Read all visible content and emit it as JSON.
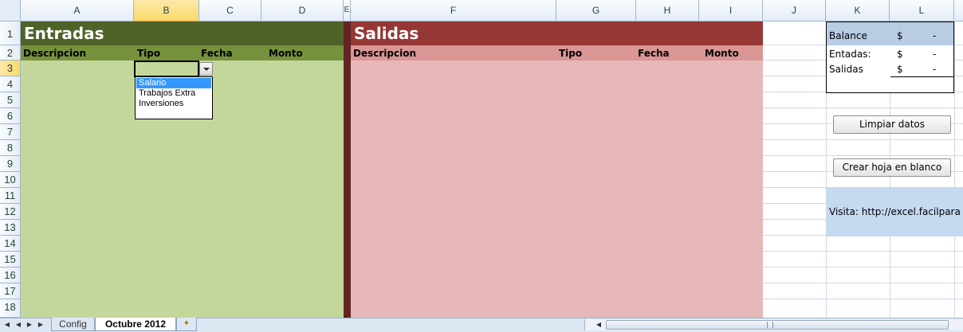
{
  "columns": [
    {
      "id": "A",
      "label": "A"
    },
    {
      "id": "B",
      "label": "B"
    },
    {
      "id": "C",
      "label": "C"
    },
    {
      "id": "D",
      "label": "D"
    },
    {
      "id": "E",
      "label": "E"
    },
    {
      "id": "F",
      "label": "F"
    },
    {
      "id": "G",
      "label": "G"
    },
    {
      "id": "H",
      "label": "H"
    },
    {
      "id": "I",
      "label": "I"
    },
    {
      "id": "J",
      "label": "J"
    },
    {
      "id": "K",
      "label": "K"
    },
    {
      "id": "L",
      "label": "L"
    }
  ],
  "rows": [
    "1",
    "2",
    "3",
    "4",
    "5",
    "6",
    "7",
    "8",
    "9",
    "10",
    "11",
    "12",
    "13",
    "14",
    "15",
    "16",
    "17",
    "18"
  ],
  "selected_cell": "B3",
  "entradas": {
    "title": "Entradas",
    "headers": {
      "descripcion": "Descripcion",
      "tipo": "Tipo",
      "fecha": "Fecha",
      "monto": "Monto"
    },
    "color_title": "#4f6228",
    "color_header": "#76923c",
    "color_body": "#c4d79b"
  },
  "salidas": {
    "title": "Salidas",
    "headers": {
      "descripcion": "Descripcion",
      "tipo": "Tipo",
      "fecha": "Fecha",
      "monto": "Monto"
    },
    "color_title": "#953735",
    "color_header": "#da9694",
    "color_body": "#e6b8b7"
  },
  "dropdown": {
    "options": [
      "Salario",
      "Trabajos Extra",
      "Inversiones"
    ],
    "highlighted_index": 0
  },
  "balance": {
    "balance_label": "Balance",
    "entradas_label": "Entadas:",
    "salidas_label": "Salidas",
    "currency": "$",
    "balance_value": "-",
    "entradas_value": "-",
    "salidas_value": "-"
  },
  "buttons": {
    "limpiar": "Limpiar datos",
    "crear": "Crear hoja en blanco"
  },
  "visit_text": "Visita: http://excel.facilpara",
  "sheet_tabs": [
    {
      "label": "Config",
      "active": false
    },
    {
      "label": "Octubre 2012",
      "active": true
    }
  ]
}
